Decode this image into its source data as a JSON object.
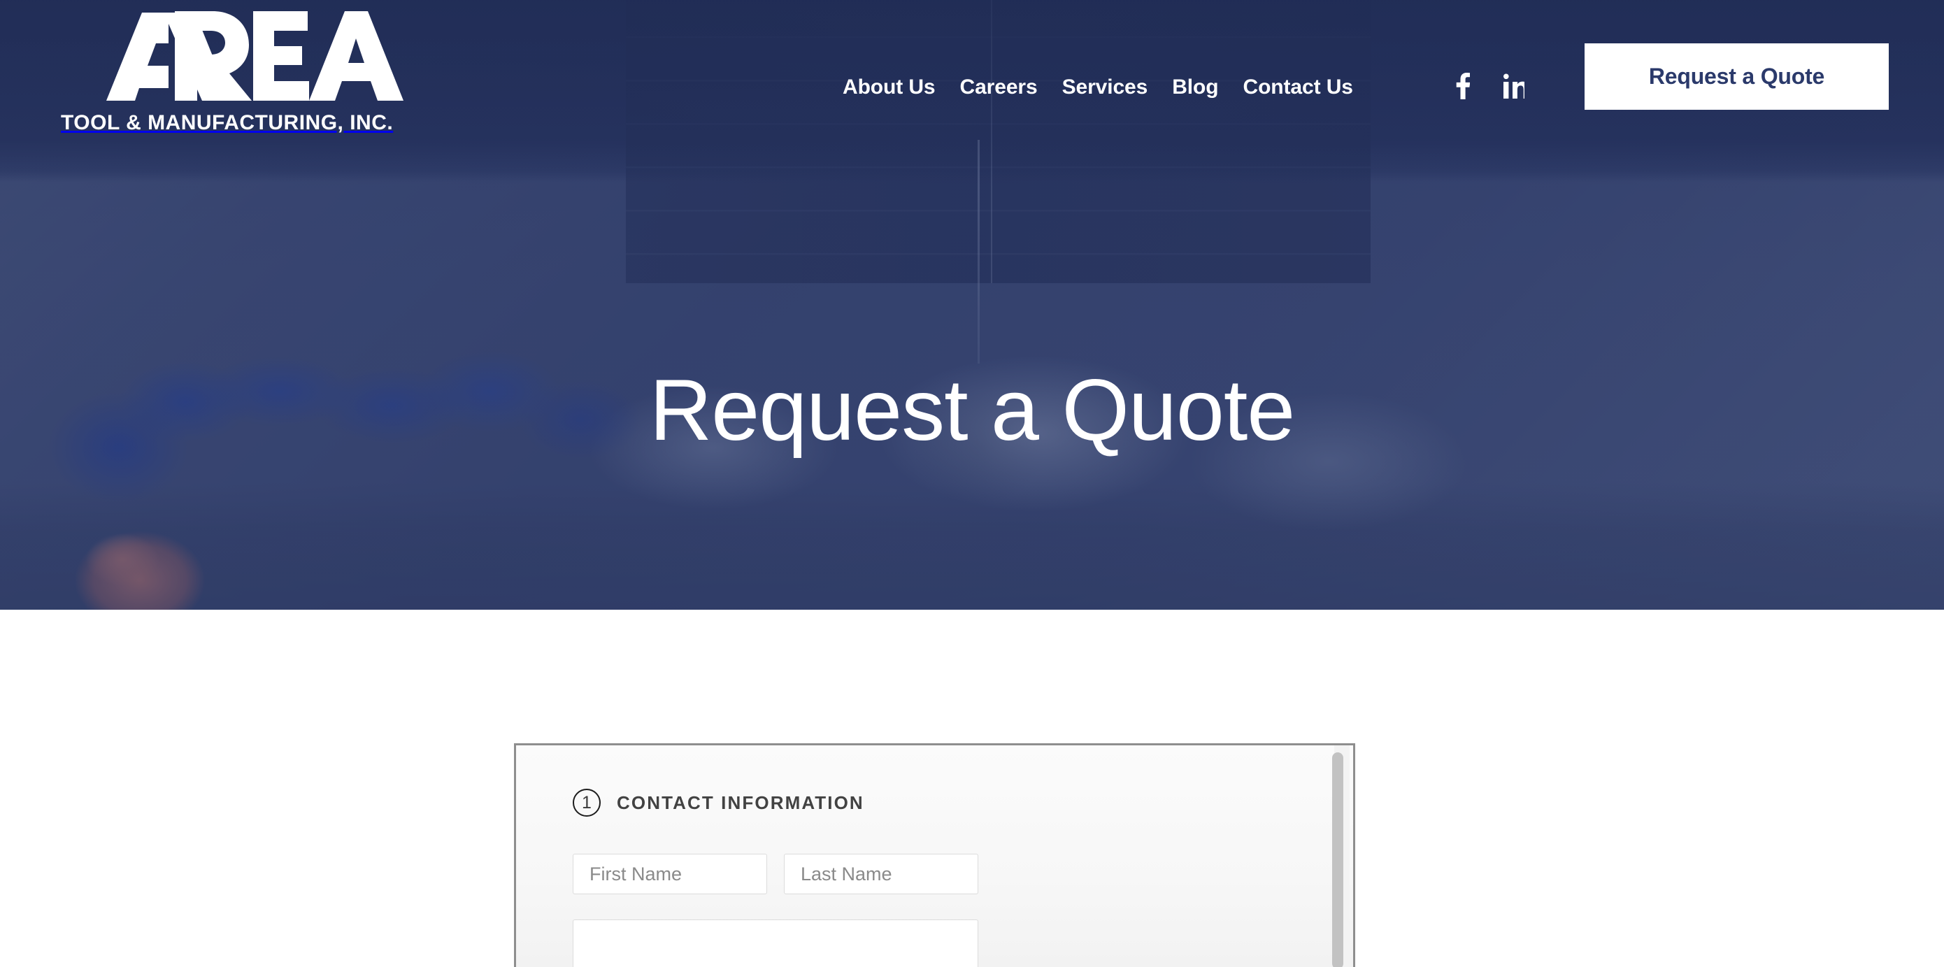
{
  "brand": {
    "logo_text": "AREA",
    "logo_subtitle": "TOOL & MANUFACTURING, INC.",
    "navy": "#2e3c68",
    "white": "#ffffff"
  },
  "header": {
    "nav": [
      {
        "label": "About Us"
      },
      {
        "label": "Careers"
      },
      {
        "label": "Services"
      },
      {
        "label": "Blog"
      },
      {
        "label": "Contact Us"
      }
    ],
    "social": [
      {
        "name": "facebook-icon",
        "glyph": "f"
      },
      {
        "name": "linkedin-icon",
        "glyph": "in"
      }
    ],
    "cta_label": "Request a Quote"
  },
  "hero": {
    "title": "Request a Quote"
  },
  "form": {
    "section": {
      "step_number": "1",
      "title": "CONTACT INFORMATION"
    },
    "fields": [
      {
        "name": "first-name",
        "placeholder": "First Name",
        "value": ""
      },
      {
        "name": "last-name",
        "placeholder": "Last Name",
        "value": ""
      },
      {
        "name": "company",
        "placeholder": "",
        "value": ""
      }
    ]
  }
}
